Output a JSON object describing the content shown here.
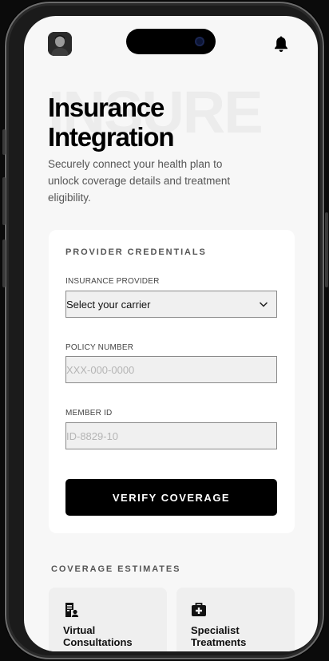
{
  "header": {
    "avatar_icon": "user-avatar",
    "bell_icon": "bell-icon"
  },
  "hero": {
    "watermark": "INSURE",
    "title_line1": "Insurance",
    "title_line2": "Integration",
    "subtitle": "Securely connect your health plan to unlock coverage details and treatment eligibility."
  },
  "credentials": {
    "section_title": "PROVIDER CREDENTIALS",
    "provider_label": "INSURANCE PROVIDER",
    "provider_value": "Select your carrier",
    "policy_label": "POLICY NUMBER",
    "policy_placeholder": "XXX-000-0000",
    "member_label": "MEMBER ID",
    "member_placeholder": "ID-8829-10",
    "verify_label": "VERIFY COVERAGE"
  },
  "coverage": {
    "section_title": "COVERAGE ESTIMATES",
    "cards": [
      {
        "label": "Virtual Consultations",
        "icon": "medical-record-icon"
      },
      {
        "label": "Specialist Treatments",
        "icon": "medical-kit-icon"
      }
    ]
  },
  "colors": {
    "primary": "#000000",
    "background": "#f7f7f7",
    "card": "#ffffff"
  }
}
